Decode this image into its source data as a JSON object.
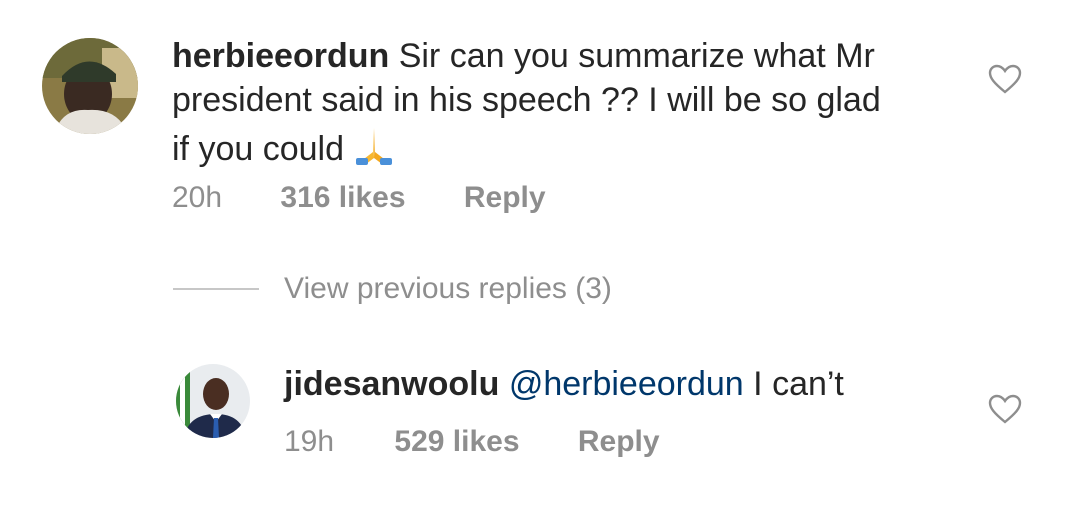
{
  "comment": {
    "username": "herbieeordun",
    "text_line1": "Sir can you summarize what Mr",
    "text_line2": "president said in his speech ?? I will be so glad",
    "text_line3": "if you could",
    "emoji": "folded-hands-emoji",
    "time": "20h",
    "likes": "316 likes",
    "reply_label": "Reply"
  },
  "view_replies_label": "View previous replies (3)",
  "reply": {
    "username": "jidesanwoolu",
    "mention": "@herbieeordun",
    "text": "I can’t",
    "time": "19h",
    "likes": "529 likes",
    "reply_label": "Reply"
  },
  "colors": {
    "text": "#262626",
    "secondary": "#8e8e8e",
    "mention": "#00376b",
    "divider": "#c7c7c7"
  }
}
